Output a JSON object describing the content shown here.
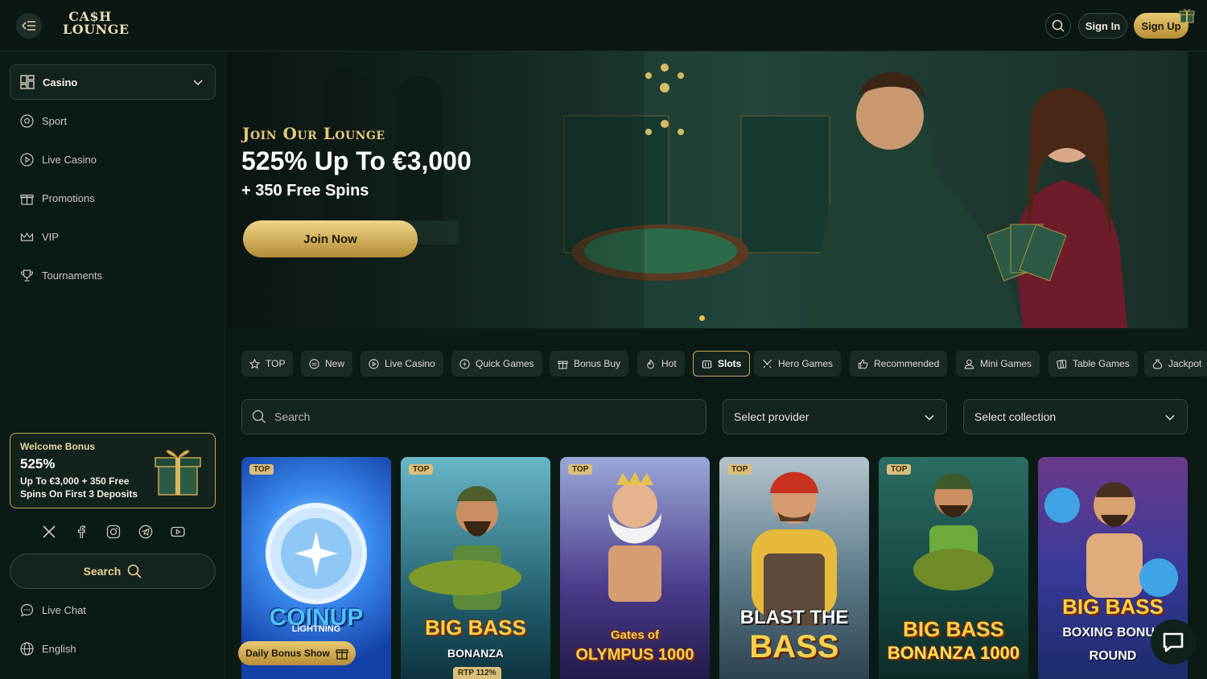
{
  "header": {
    "logo_line1": "CA$H",
    "logo_line2": "LOUNGE",
    "sign_in_label": "Sign In",
    "sign_up_label": "Sign Up"
  },
  "sidebar": {
    "selector_label": "Casino",
    "items": [
      {
        "label": "Sport",
        "icon": "soccer-ball-icon"
      },
      {
        "label": "Live Casino",
        "icon": "play-circle-icon"
      },
      {
        "label": "Promotions",
        "icon": "gift-icon"
      },
      {
        "label": "VIP",
        "icon": "crown-icon"
      },
      {
        "label": "Tournaments",
        "icon": "trophy-icon"
      }
    ],
    "bonus": {
      "title": "Welcome Bonus",
      "amount": "525%",
      "details": "Up To €3,000 + 350 Free Spins On First 3 Deposits"
    },
    "socials": [
      "x-icon",
      "facebook-icon",
      "instagram-icon",
      "telegram-icon",
      "youtube-icon"
    ],
    "search_label": "Search",
    "bottom_items": [
      {
        "label": "Live Chat",
        "icon": "chat-icon"
      },
      {
        "label": "English",
        "icon": "globe-icon"
      }
    ]
  },
  "banner": {
    "kicker": "Join Our Lounge",
    "headline": "525% Up To €3,000",
    "subline": "+ 350 Free Spins",
    "cta_label": "Join Now"
  },
  "categories": [
    {
      "label": "TOP",
      "icon": "star-icon",
      "active": false
    },
    {
      "label": "New",
      "icon": "new-icon",
      "active": false
    },
    {
      "label": "Live Casino",
      "icon": "play-circle-icon",
      "active": false
    },
    {
      "label": "Quick Games",
      "icon": "lightning-icon",
      "active": false
    },
    {
      "label": "Bonus Buy",
      "icon": "gift-icon",
      "active": false
    },
    {
      "label": "Hot",
      "icon": "flame-icon",
      "active": false
    },
    {
      "label": "Slots",
      "icon": "slot-machine-icon",
      "active": true
    },
    {
      "label": "Hero Games",
      "icon": "sword-icon",
      "active": false
    },
    {
      "label": "Recommended",
      "icon": "thumbs-up-icon",
      "active": false
    },
    {
      "label": "Mini Games",
      "icon": "person-icon",
      "active": false
    },
    {
      "label": "Table Games",
      "icon": "cards-icon",
      "active": false
    },
    {
      "label": "Jackpot",
      "icon": "money-bag-icon",
      "active": false
    }
  ],
  "filters": {
    "search_placeholder": "Search",
    "provider_label": "Select provider",
    "collection_label": "Select collection"
  },
  "games": [
    {
      "name_line1": "COIN",
      "name_line2": "UP",
      "badge": "TOP",
      "bg": "#1a56c8",
      "extra": "LIGHTNING"
    },
    {
      "name_line1": "BIG BASS",
      "name_line2": "BONANZA",
      "badge": "TOP",
      "bg": "#2f6a78",
      "rtp": "RTP 112%"
    },
    {
      "name_line1": "Gates of",
      "name_line2": "OLYMPUS 1000",
      "badge": "TOP",
      "bg": "#3b2e6e"
    },
    {
      "name_line1": "BLAST THE",
      "name_line2": "BASS",
      "badge": "TOP",
      "bg": "#7a8f9c"
    },
    {
      "name_line1": "BIG BASS",
      "name_line2": "BONANZA 1000",
      "badge": "TOP",
      "bg": "#1f5e52"
    },
    {
      "name_line1": "BIG BASS",
      "name_line2": "BOXING BONUS ROUND",
      "badge": "",
      "bg": "#2a3c8a"
    }
  ],
  "daily_bonus_label": "Daily Bonus Show"
}
